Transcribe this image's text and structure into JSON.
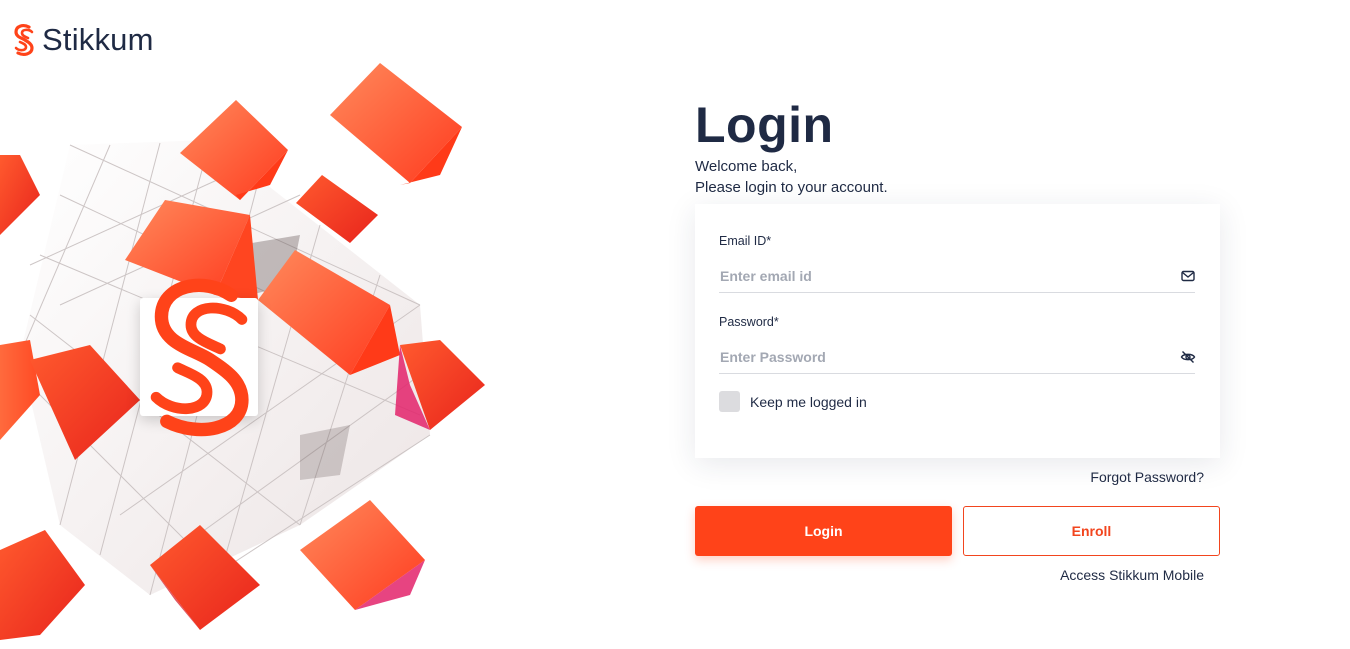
{
  "brand": {
    "name": "Stikkum",
    "logo_icon": "stikkum-s-icon",
    "accent_color": "#ff4319",
    "text_color": "#1f2a44"
  },
  "hero": {
    "image": "cube-illustration"
  },
  "login": {
    "title": "Login",
    "welcome_line1": "Welcome back,",
    "welcome_line2": "Please login to your account.",
    "email": {
      "label": "Email ID*",
      "placeholder": "Enter email id",
      "value": "",
      "icon": "mail-icon"
    },
    "password": {
      "label": "Password*",
      "placeholder": "Enter Password",
      "value": "",
      "icon": "eye-off-icon"
    },
    "remember": {
      "label": "Keep me logged in",
      "checked": false
    },
    "forgot_label": "Forgot Password?",
    "login_button": "Login",
    "enroll_button": "Enroll",
    "mobile_link": "Access Stikkum Mobile"
  }
}
